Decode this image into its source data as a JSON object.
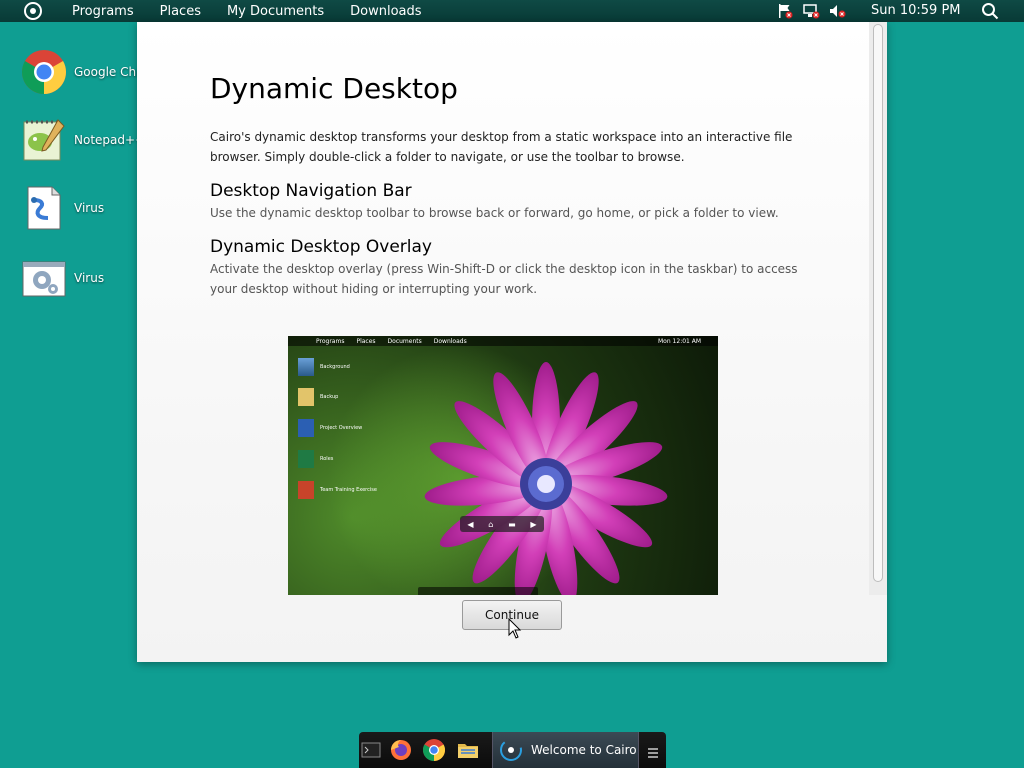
{
  "menubar": {
    "items": [
      "Programs",
      "Places",
      "My Documents",
      "Downloads"
    ],
    "clock": "Sun 10:59 PM",
    "tray_icons": [
      "flag-alert-icon",
      "network-disconnected-icon",
      "volume-muted-icon"
    ]
  },
  "desktop": {
    "icons": [
      {
        "label": "Google Chro",
        "icon": "chrome-icon"
      },
      {
        "label": "Notepad++",
        "icon": "notepadpp-icon"
      },
      {
        "label": "Virus",
        "icon": "script-file-icon"
      },
      {
        "label": "Virus",
        "icon": "settings-file-icon"
      }
    ]
  },
  "window": {
    "title": "Dynamic Desktop",
    "intro": "Cairo's dynamic desktop transforms your desktop from a static workspace into an interactive file browser. Simply double-click a folder to navigate, or use the toolbar to browse.",
    "sections": [
      {
        "heading": "Desktop Navigation Bar",
        "text": "Use the dynamic desktop toolbar to browse back or forward, go home, or pick a folder to view."
      },
      {
        "heading": "Dynamic Desktop Overlay",
        "text": "Activate the desktop overlay (press Win-Shift-D or click the desktop icon in the taskbar) to access your desktop without hiding or interrupting your work."
      }
    ],
    "preview": {
      "menu_items": [
        "Programs",
        "Places",
        "Documents",
        "Downloads"
      ],
      "clock": "Mon 12:01 AM",
      "icons": [
        "Background",
        "Backup",
        "Project Overview",
        "Roles",
        "Team Training Exercise"
      ]
    },
    "continue_label": "Continue"
  },
  "taskbar": {
    "pinned": [
      "terminal-icon",
      "firefox-icon",
      "chrome-icon",
      "folder-icon"
    ],
    "active_window": "Welcome to Cairo",
    "colors": {
      "accent": "#0f9e92",
      "bar": "#0b0b0b"
    }
  }
}
